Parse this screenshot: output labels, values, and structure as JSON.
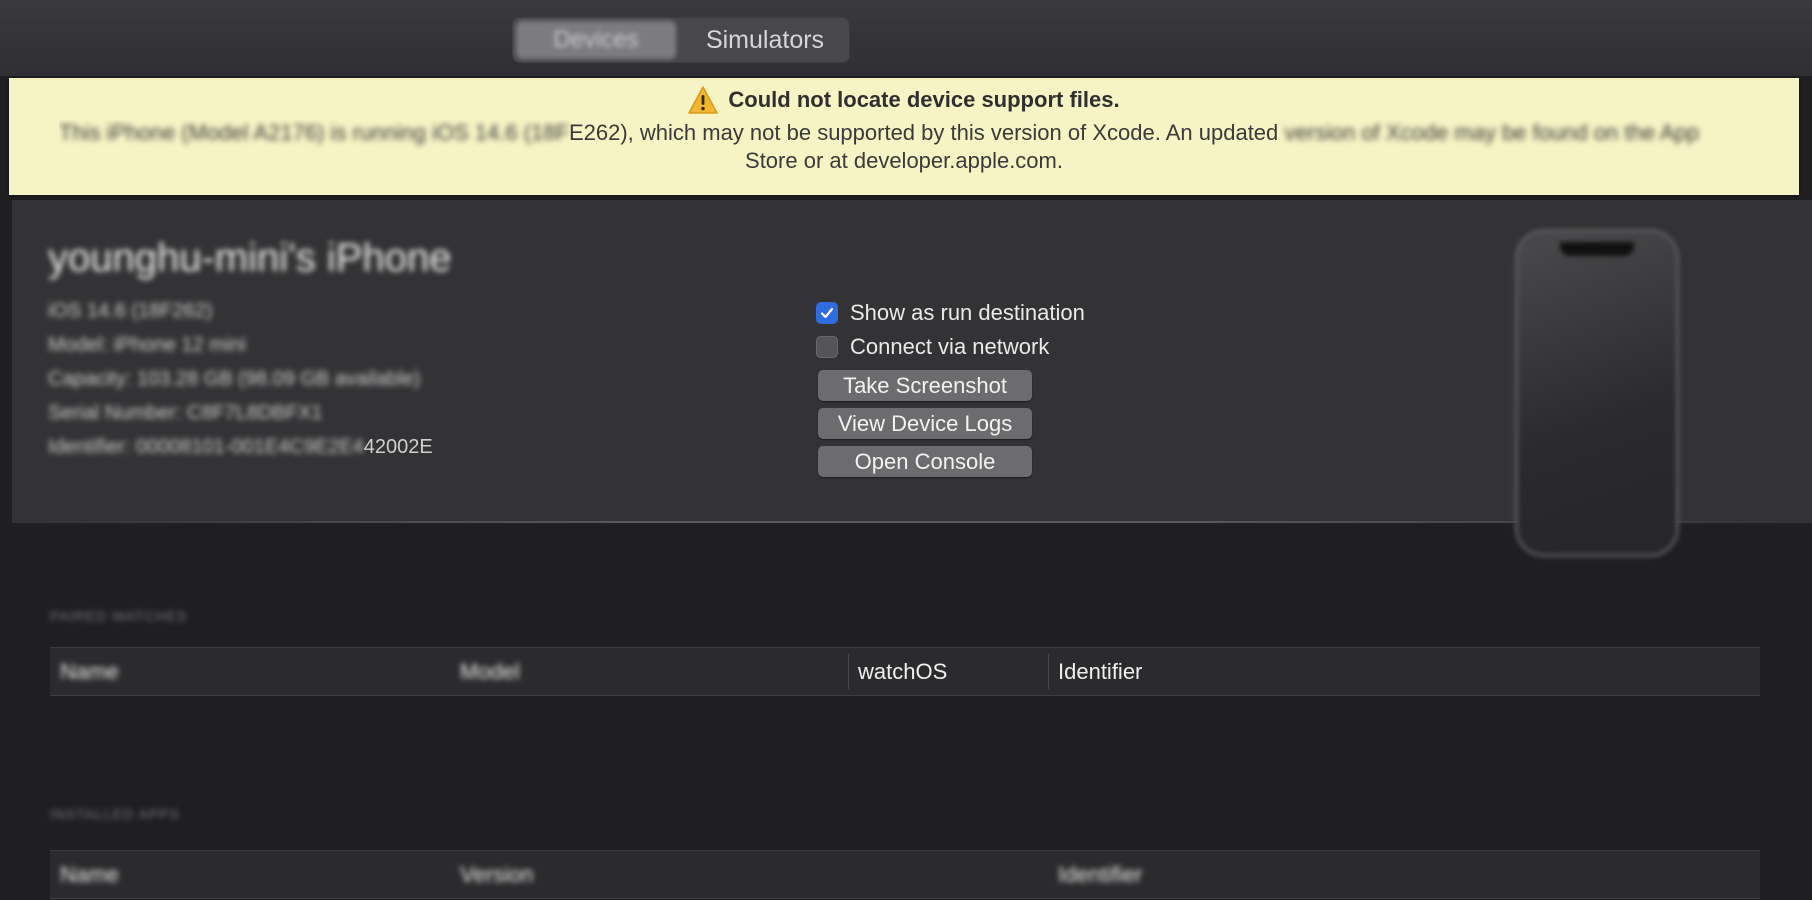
{
  "toolbar": {
    "tabs": [
      {
        "label": "Devices",
        "selected": true
      },
      {
        "label": "Simulators",
        "selected": false
      }
    ]
  },
  "banner": {
    "title": "Could not locate device support files.",
    "line1_blurred": "This iPhone (Model A2176) is running iOS 14.6 (18F",
    "line1_clear": "E262), which may not be supported by this version of Xcode. An updated",
    "line1_tail": "version of Xcode may be found on the App",
    "line2": "Store or at developer.apple.com.",
    "background_color": "#f6f3c4",
    "icon": "warning-icon"
  },
  "device": {
    "name": "younghu-mini's iPhone",
    "info": [
      "iOS 14.6 (18F262)",
      "Model: iPhone 12 mini",
      "Capacity: 103.28 GB (98.09 GB available)",
      "Serial Number: C8F7L8DBFX1",
      "Identifier: 00008101-001E4C9E2E4",
      "42002E"
    ],
    "options": [
      {
        "label": "Show as run destination",
        "checked": true
      },
      {
        "label": "Connect via network",
        "checked": false
      }
    ],
    "buttons": [
      "Take Screenshot",
      "View Device Logs",
      "Open Console"
    ]
  },
  "paired_watches": {
    "section_label": "PAIRED WATCHES",
    "columns": [
      "Name",
      "Model",
      "watchOS",
      "Identifier"
    ]
  },
  "installed_apps": {
    "section_label": "INSTALLED APPS",
    "columns": [
      "Name",
      "Version",
      "Identifier"
    ]
  }
}
